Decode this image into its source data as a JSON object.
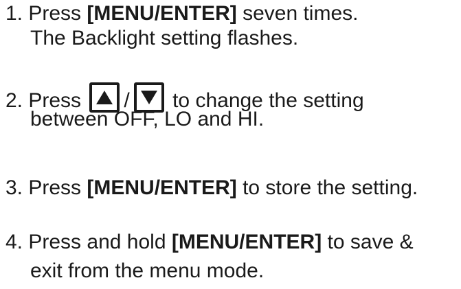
{
  "steps": [
    {
      "number": "1.",
      "line1_prefix": "Press",
      "line1_bold": "[MENU/ENTER]",
      "line1_suffix": "seven times.",
      "line2": "The Backlight setting flashes."
    },
    {
      "number": "2.",
      "line1_prefix": "Press",
      "icon_up": "up-arrow-key-icon",
      "separator": "/",
      "icon_down": "down-arrow-key-icon",
      "line1_suffix": "to change the setting",
      "line2": "between OFF, LO and HI."
    },
    {
      "number": "3.",
      "line1_prefix": "Press",
      "line1_bold": "[MENU/ENTER]",
      "line1_suffix": "to store the setting."
    },
    {
      "number": "4.",
      "line1_prefix": "Press and hold",
      "line1_bold": "[MENU/ENTER]",
      "line1_suffix": "to save &",
      "line2": "exit from the menu mode."
    }
  ]
}
